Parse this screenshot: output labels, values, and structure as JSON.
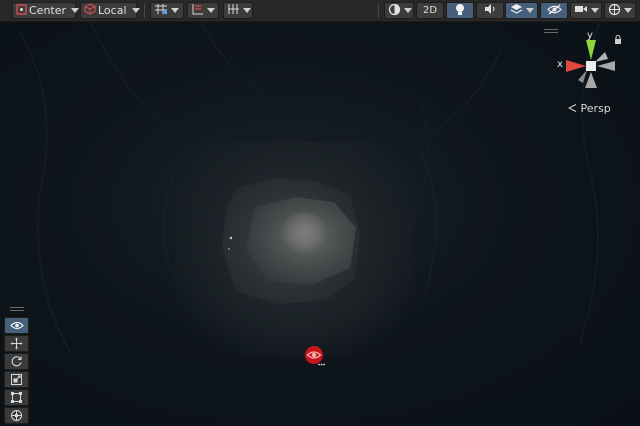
{
  "toolbar": {
    "pivot_label": "Center",
    "space_label": "Local",
    "view_2d_label": "2D"
  },
  "gizmo": {
    "y_label": "y",
    "x_label": "x",
    "projection_label": "Persp"
  },
  "colors": {
    "toolbar_bg": "#282828",
    "button_bg": "#3c3c3c",
    "active_blue": "#46607c",
    "scene_bg": "#0b1218",
    "gizmo_y": "#8fd43a",
    "gizmo_x": "#e0483e",
    "marker_red": "#c8141c"
  },
  "tools": [
    {
      "name": "view-tool",
      "icon": "eye-icon",
      "active": true
    },
    {
      "name": "move-tool",
      "icon": "move-arrows-icon",
      "active": false
    },
    {
      "name": "rotate-tool",
      "icon": "rotate-icon",
      "active": false
    },
    {
      "name": "scale-tool",
      "icon": "scale-icon",
      "active": false
    },
    {
      "name": "rect-tool",
      "icon": "rect-transform-icon",
      "active": false
    },
    {
      "name": "transform-tool",
      "icon": "transform-icon",
      "active": false
    }
  ]
}
